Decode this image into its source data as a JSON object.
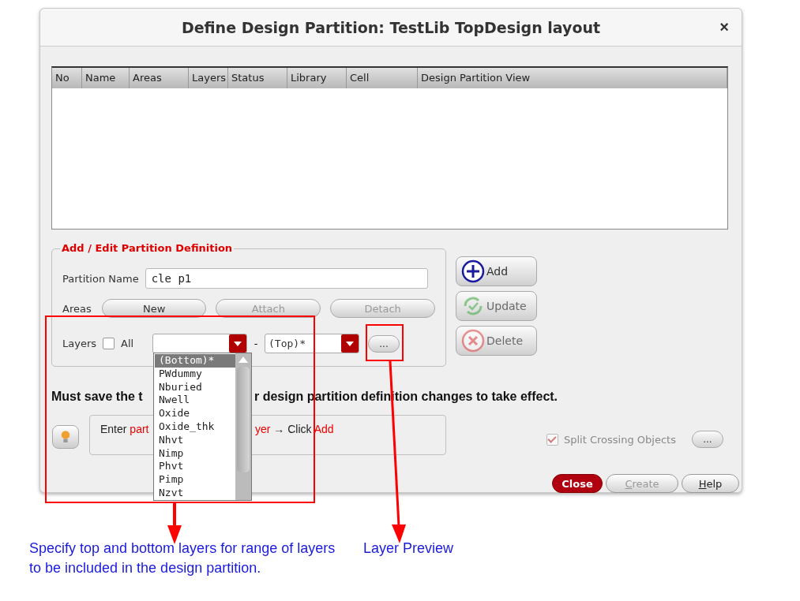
{
  "window": {
    "title": "Define Design Partition: TestLib TopDesign layout",
    "close": "×"
  },
  "table": {
    "columns": [
      "No",
      "Name",
      "Areas",
      "Layers",
      "Status",
      "Library",
      "Cell",
      "Design Partition View"
    ]
  },
  "group": {
    "title": "Add / Edit Partition Definition",
    "name_label": "Partition Name",
    "name_value": "cle_p1",
    "areas_label": "Areas",
    "area_buttons": [
      {
        "label": "New",
        "disabled": false
      },
      {
        "label": "Attach",
        "disabled": true
      },
      {
        "label": "Detach",
        "disabled": true
      }
    ],
    "layers_label": "Layers",
    "all": {
      "label": "All",
      "checked": false
    },
    "separator": "-",
    "to_layer": "(Top)*",
    "preview_button": "..."
  },
  "side_buttons": [
    {
      "label": "Add",
      "kind": "add",
      "disabled": false
    },
    {
      "label": "Update",
      "kind": "update",
      "disabled": true
    },
    {
      "label": "Delete",
      "kind": "delete",
      "disabled": true
    }
  ],
  "layer_list": {
    "items": [
      {
        "label": "(Bottom)*",
        "selected": true
      },
      {
        "label": "PWdummy",
        "selected": false
      },
      {
        "label": "Nburied",
        "selected": false
      },
      {
        "label": "Nwell",
        "selected": false
      },
      {
        "label": "Oxide",
        "selected": false
      },
      {
        "label": "Oxide_thk",
        "selected": false
      },
      {
        "label": "Nhvt",
        "selected": false
      },
      {
        "label": "Nimp",
        "selected": false
      },
      {
        "label": "Phvt",
        "selected": false
      },
      {
        "label": "Pimp",
        "selected": false
      },
      {
        "label": "Nzvt",
        "selected": false
      }
    ]
  },
  "notice": {
    "start": "Must save the t",
    "end": "r design partition definition changes to take effect."
  },
  "hint": {
    "start": [
      {
        "text": "Enter ",
        "highlight": false
      },
      {
        "text": "part",
        "highlight": true
      }
    ],
    "end": [
      {
        "text": "yer",
        "highlight": true
      },
      {
        "text": " → Click ",
        "highlight": false
      },
      {
        "text": "Add",
        "highlight": true
      }
    ]
  },
  "split": {
    "label": "Split Crossing Objects",
    "checked": true,
    "disabled": true,
    "button": "..."
  },
  "footer_buttons": [
    {
      "label": "Close",
      "kind": "primary",
      "disabled": false,
      "underline_first": false
    },
    {
      "label": "Create",
      "kind": "normal",
      "disabled": true,
      "underline_first": true
    },
    {
      "label": "Help",
      "kind": "normal",
      "disabled": false,
      "underline_first": true
    }
  ],
  "annotations": [
    {
      "text": "Specify top and bottom layers for range of layers to be included in the design partition."
    },
    {
      "text": "Layer Preview"
    }
  ]
}
